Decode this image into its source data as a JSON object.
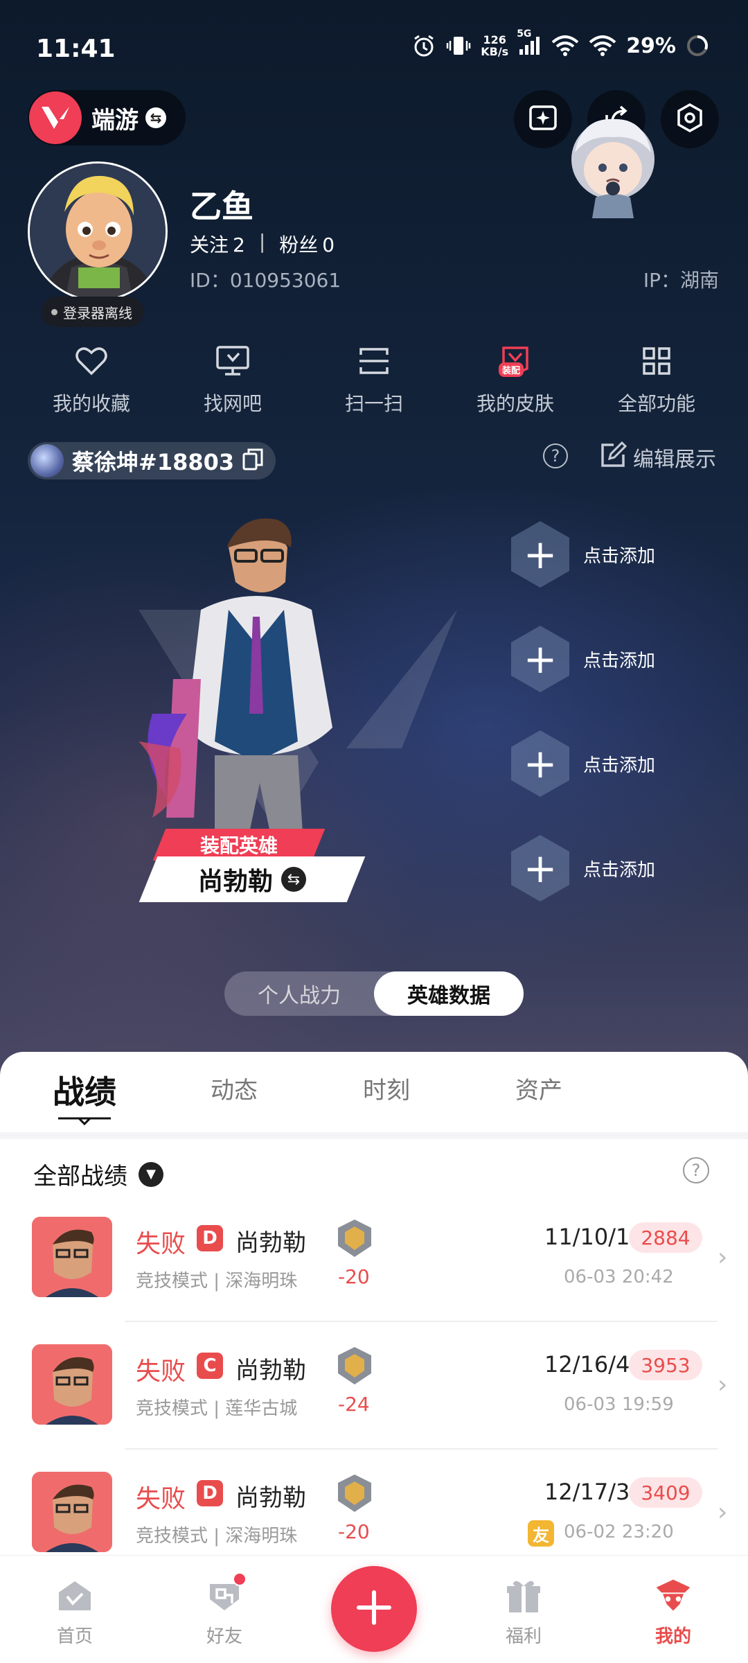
{
  "status_bar": {
    "time": "11:41",
    "net_speed_value": "126",
    "net_speed_unit": "KB/s",
    "network_type": "5G",
    "battery": "29%"
  },
  "header": {
    "app_name": "端游"
  },
  "profile": {
    "nickname": "乙鱼",
    "following_label": "关注",
    "following_count": "2",
    "followers_label": "粉丝",
    "followers_count": "0",
    "separator": "|",
    "uid": "ID：010953061",
    "ip": "IP：湖南",
    "launcher_status": "登录器离线"
  },
  "quick_actions": [
    {
      "label": "我的收藏",
      "icon": "heart-icon"
    },
    {
      "label": "找网吧",
      "icon": "monitor-icon"
    },
    {
      "label": "扫一扫",
      "icon": "scan-icon"
    },
    {
      "label": "我的皮肤",
      "icon": "skin-icon",
      "tag": "装配"
    },
    {
      "label": "全部功能",
      "icon": "grid-icon"
    }
  ],
  "game_account": {
    "name": "蔡徐坤#18803",
    "edit_label": "编辑展示"
  },
  "hero": {
    "tag": "装配英雄",
    "name": "尚勃勒",
    "add_slots": [
      "点击添加",
      "点击添加",
      "点击添加",
      "点击添加"
    ]
  },
  "segment": {
    "options": [
      "个人战力",
      "英雄数据"
    ],
    "selected": "英雄数据"
  },
  "tabs": [
    "战绩",
    "动态",
    "时刻",
    "资产"
  ],
  "active_tab": "战绩",
  "filter": {
    "label": "全部战绩"
  },
  "matches": [
    {
      "result": "失败",
      "grade": "D",
      "hero": "尚勃勒",
      "mode": "竞技模式 | 深海明珠",
      "delta": "-20",
      "kda": "11/10/1",
      "score": "2884",
      "time": "06-03 20:42",
      "friend": ""
    },
    {
      "result": "失败",
      "grade": "C",
      "hero": "尚勃勒",
      "mode": "竞技模式 | 莲华古城",
      "delta": "-24",
      "kda": "12/16/4",
      "score": "3953",
      "time": "06-03 19:59",
      "friend": ""
    },
    {
      "result": "失败",
      "grade": "D",
      "hero": "尚勃勒",
      "mode": "竞技模式 | 深海明珠",
      "delta": "-20",
      "kda": "12/17/3",
      "score": "3409",
      "time": "06-02 23:20",
      "friend": "友"
    }
  ],
  "bottom_nav": [
    {
      "label": "首页",
      "icon": "home-icon"
    },
    {
      "label": "好友",
      "icon": "friends-icon",
      "badge": true
    },
    {
      "label": "",
      "icon": "plus-icon"
    },
    {
      "label": "福利",
      "icon": "gift-icon"
    },
    {
      "label": "我的",
      "icon": "profile-icon",
      "active": true
    }
  ],
  "colors": {
    "accent": "#ef3e55",
    "loss": "#e94c4c",
    "score_bg": "#fde4e6"
  }
}
